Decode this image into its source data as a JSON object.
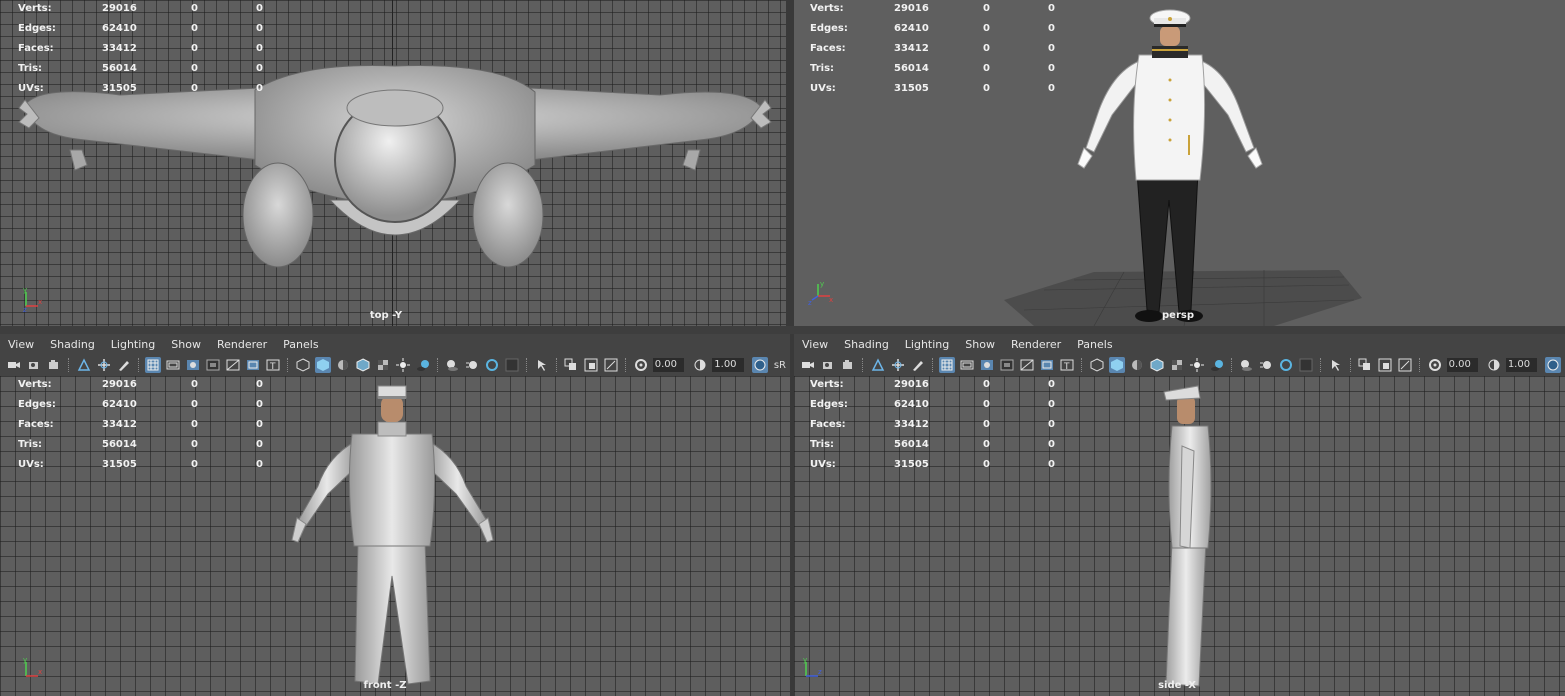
{
  "stats": [
    {
      "label": "Verts:",
      "v1": "29016",
      "v2": "0",
      "v3": "0"
    },
    {
      "label": "Edges:",
      "v1": "62410",
      "v2": "0",
      "v3": "0"
    },
    {
      "label": "Faces:",
      "v1": "33412",
      "v2": "0",
      "v3": "0"
    },
    {
      "label": "Tris:",
      "v1": "56014",
      "v2": "0",
      "v3": "0"
    },
    {
      "label": "UVs:",
      "v1": "31505",
      "v2": "0",
      "v3": "0"
    }
  ],
  "cameras": {
    "top": "top -Y",
    "persp": "persp",
    "front": "front -Z",
    "side": "side -X"
  },
  "panel_menu": [
    "View",
    "Shading",
    "Lighting",
    "Show",
    "Renderer",
    "Panels"
  ],
  "toolbar": {
    "exposure": "0.00",
    "gamma": "1.00",
    "colorspace": "sR"
  },
  "colors": {
    "viewport_bg": "#5e5e5e",
    "panel_bg": "#444444",
    "active_button": "#5a86b0",
    "axis_y": "#4fd14f",
    "axis_x": "#e04040",
    "axis_z": "#4060e0"
  }
}
